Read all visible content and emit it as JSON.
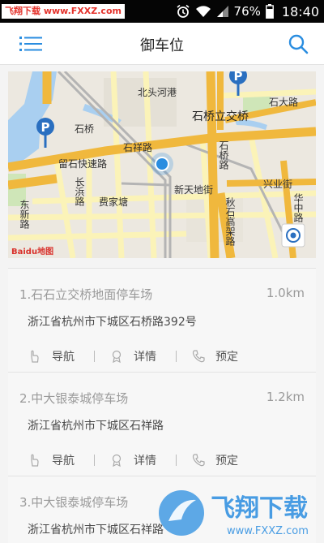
{
  "statusbar": {
    "watermark": "飞翔下载 www.FXXZ.com",
    "battery": "76%",
    "time": "18:40"
  },
  "header": {
    "title": "御车位"
  },
  "map": {
    "labels": {
      "beitou": "北头河港",
      "shiqiao": "石桥",
      "shiqiao_bridge": "石桥立交桥",
      "shida_road": "石大路",
      "shiqiao_road": "石桥路",
      "liushi_expressway": "留石快速路",
      "shixiang_road": "石祥路",
      "changbin_road": "长浜路",
      "feijiatang": "费家塘",
      "xintiandi_street": "新天地街",
      "dongxin_road": "东新路",
      "qiushi_highway": "秋石高架路",
      "xingye_street": "兴业街",
      "huazhong_road": "华中路",
      "baidu": "Baidu地图",
      "top_left_road": "路"
    }
  },
  "actions": {
    "navigate": "导航",
    "details": "详情",
    "reserve": "预定"
  },
  "parking": [
    {
      "name": "1.石石立交桥地面停车场",
      "distance": "1.0km",
      "address": "浙江省杭州市下城区石桥路392号"
    },
    {
      "name": "2.中大银泰城停车场",
      "distance": "1.2km",
      "address": "浙江省杭州市下城区石祥路"
    },
    {
      "name": "3.中大银泰城停车场",
      "distance": "",
      "address": "浙江省杭州市下城区石祥路"
    }
  ],
  "watermark_bottom": {
    "brand": "飞翔下载",
    "url": "www.FXXZ.com"
  },
  "colors": {
    "accent": "#2a8de0",
    "major_road": "#f0b83d",
    "minor_road": "#fbf3b8",
    "statusbar": "#050505"
  }
}
